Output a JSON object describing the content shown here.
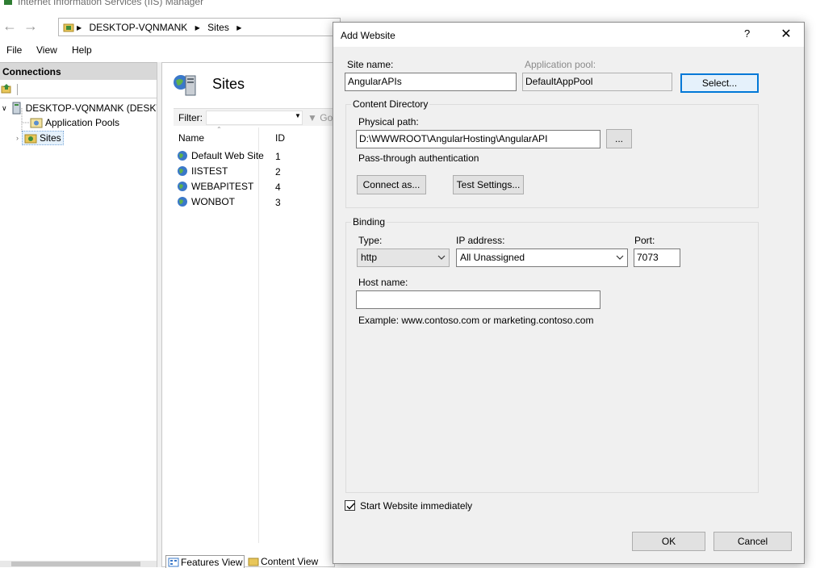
{
  "window": {
    "title": "Internet Information Services (IIS) Manager"
  },
  "address": {
    "crumbs": [
      "DESKTOP-VQNMANK",
      "Sites"
    ]
  },
  "menu": {
    "items": [
      "File",
      "View",
      "Help"
    ]
  },
  "connections": {
    "header": "Connections",
    "tree": {
      "server": "DESKTOP-VQNMANK (DESKTO",
      "app_pools": "Application Pools",
      "sites": "Sites"
    }
  },
  "sites_panel": {
    "title": "Sites",
    "filter_label": "Filter:",
    "go_label": "Go",
    "columns": [
      "Name",
      "ID"
    ],
    "rows": [
      {
        "name": "Default Web Site",
        "id": "1"
      },
      {
        "name": "IISTEST",
        "id": "2"
      },
      {
        "name": "WEBAPITEST",
        "id": "4"
      },
      {
        "name": "WONBOT",
        "id": "3"
      }
    ],
    "tabs": [
      "Features View",
      "Content View"
    ]
  },
  "dialog": {
    "title": "Add Website",
    "help": "?",
    "site_name_label": "Site name:",
    "site_name_value": "AngularAPIs",
    "app_pool_label": "Application pool:",
    "app_pool_value": "DefaultAppPool",
    "select_button": "Select...",
    "content_dir": {
      "title": "Content Directory",
      "physical_path_label": "Physical path:",
      "physical_path_value": "D:\\WWWROOT\\AngularHosting\\AngularAPI",
      "browse_button": "...",
      "passthrough_label": "Pass-through authentication",
      "connect_button": "Connect as...",
      "test_button": "Test Settings..."
    },
    "binding": {
      "title": "Binding",
      "type_label": "Type:",
      "type_value": "http",
      "ip_label": "IP address:",
      "ip_value": "All Unassigned",
      "port_label": "Port:",
      "port_value": "7073",
      "host_label": "Host name:",
      "host_value": "",
      "example": "Example: www.contoso.com or marketing.contoso.com"
    },
    "start_immediately": {
      "label": "Start Website immediately",
      "checked": true
    },
    "ok_button": "OK",
    "cancel_button": "Cancel"
  }
}
